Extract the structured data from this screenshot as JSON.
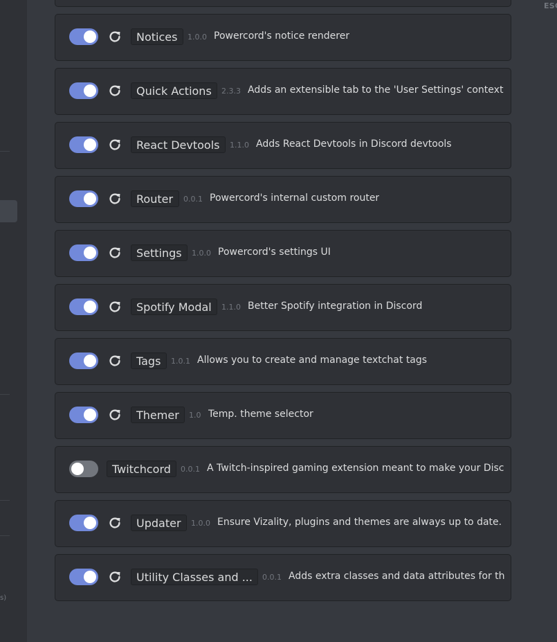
{
  "header": {
    "esc_label": "ESC"
  },
  "sidebar": {
    "fragment_text": "s)"
  },
  "plugins": [
    {
      "name": "Notices",
      "version": "1.0.0",
      "description": "Powercord's notice renderer",
      "enabled": true,
      "reload": true
    },
    {
      "name": "Quick Actions",
      "version": "2.3.3",
      "description": "Adds an extensible tab to the 'User Settings' context ...",
      "enabled": true,
      "reload": true
    },
    {
      "name": "React Devtools",
      "version": "1.1.0",
      "description": "Adds React Devtools in Discord devtools",
      "enabled": true,
      "reload": true
    },
    {
      "name": "Router",
      "version": "0.0.1",
      "description": "Powercord's internal custom router",
      "enabled": true,
      "reload": true
    },
    {
      "name": "Settings",
      "version": "1.0.0",
      "description": "Powercord's settings UI",
      "enabled": true,
      "reload": true
    },
    {
      "name": "Spotify Modal",
      "version": "1.1.0",
      "description": "Better Spotify integration in Discord",
      "enabled": true,
      "reload": true
    },
    {
      "name": "Tags",
      "version": "1.0.1",
      "description": "Allows you to create and manage textchat tags",
      "enabled": true,
      "reload": true
    },
    {
      "name": "Themer",
      "version": "1.0",
      "description": "Temp. theme selector",
      "enabled": true,
      "reload": true
    },
    {
      "name": "Twitchcord",
      "version": "0.0.1",
      "description": "A Twitch-inspired gaming extension meant to make your Disc...",
      "enabled": false,
      "reload": false
    },
    {
      "name": "Updater",
      "version": "1.0.0",
      "description": "Ensure Vizality, plugins and themes are always up to date.",
      "enabled": true,
      "reload": true
    },
    {
      "name": "Utility Classes and ...",
      "version": "0.0.1",
      "description": "Adds extra classes and data attributes for th...",
      "enabled": true,
      "reload": true
    }
  ],
  "colors": {
    "accent": "#7289da",
    "toggle_off": "#72767d",
    "card_bg": "#2f3136",
    "page_bg": "#36393f"
  },
  "icons": {
    "reload": "reload-icon"
  }
}
